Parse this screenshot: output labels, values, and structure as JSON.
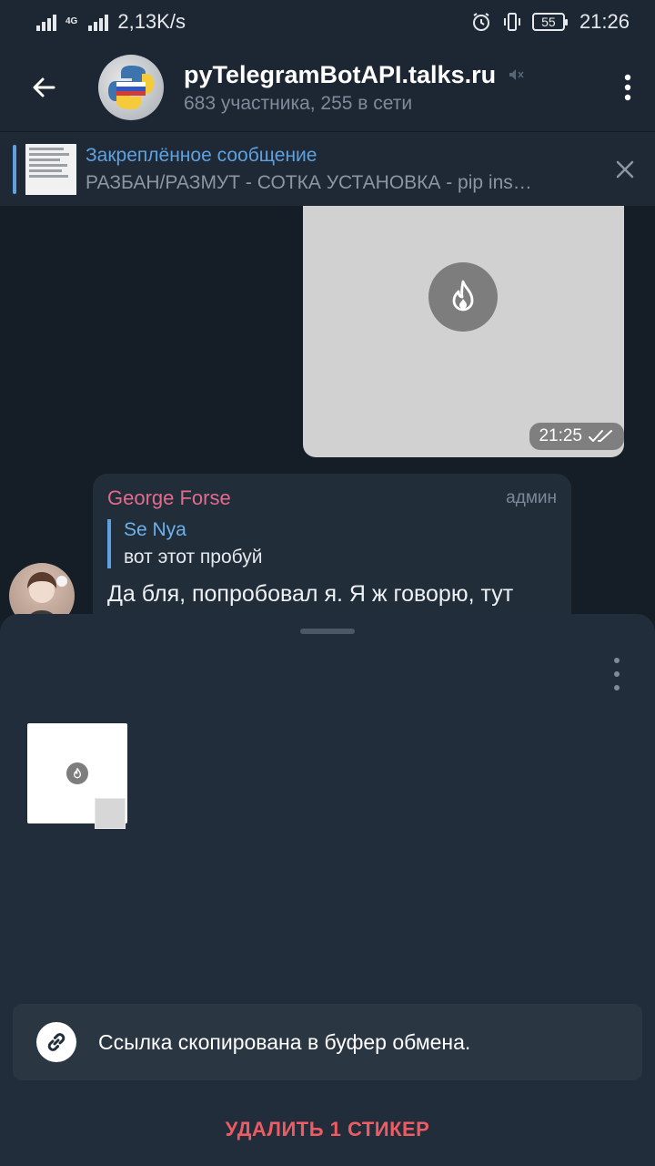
{
  "status_bar": {
    "network_type": "4G",
    "speed": "2,13K/s",
    "battery": "55",
    "time": "21:26"
  },
  "header": {
    "back_icon": "arrow-left-icon",
    "title": "pyTelegramBotAPI.talks.ru",
    "muted_icon": "speaker-muted-icon",
    "subtitle": "683 участника, 255 в сети",
    "menu_icon": "more-vertical-icon"
  },
  "pinned": {
    "title": "Закреплённое сообщение",
    "body": "РАЗБАН/РАЗМУТ - СОТКА  УСТАНОВКА - pip ins…",
    "close_icon": "close-icon"
  },
  "messages": {
    "outgoing_media": {
      "icon": "fire-icon",
      "time": "21:25",
      "status_icon": "double-check-icon"
    },
    "incoming": {
      "sender": "George Forse",
      "role": "админ",
      "reply_name": "Se Nya",
      "reply_text": "вот этот пробуй",
      "text": "Да бля, попробовал я. Я ж говорю, тут"
    }
  },
  "sheet": {
    "menu_icon": "more-vertical-icon",
    "sticker_icon": "fire-icon",
    "toast": {
      "icon": "link-icon",
      "text": "Ссылка скопирована в буфер обмена."
    },
    "delete_label": "УДАЛИТЬ 1 СТИКЕР"
  },
  "colors": {
    "accent": "#5ea1e0",
    "sender_name": "#e26b8c",
    "danger": "#ee5b62"
  }
}
